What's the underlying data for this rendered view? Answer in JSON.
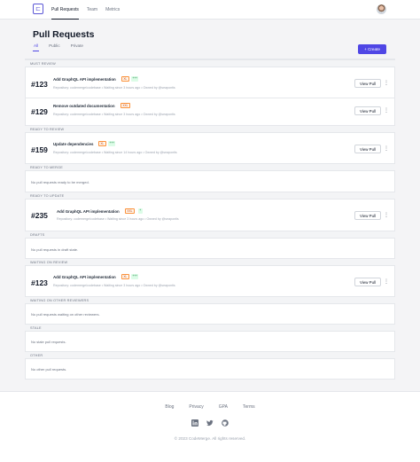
{
  "topbar": {
    "logo_glyph": "⊏",
    "nav": [
      "Pull Requests",
      "Team",
      "Metrics"
    ]
  },
  "header": {
    "title": "Pull Requests",
    "tabs": [
      "All",
      "Public",
      "Private"
    ],
    "create_label": "+ Create"
  },
  "sections": [
    {
      "heading": "MUST REVIEW"
    },
    {
      "heading": "READY TO REVIEW"
    },
    {
      "heading": "READY TO MERGE",
      "empty": "No pull requests ready to be merged."
    },
    {
      "heading": "READY TO UPDATE"
    },
    {
      "heading": "DRAFTS",
      "empty": "No pull requests in draft state."
    },
    {
      "heading": "WAITING ON REVIEW"
    },
    {
      "heading": "WAITING ON OTHER REVIEWERS",
      "empty": "No pull requests waiting on other reviewers."
    },
    {
      "heading": "STALE",
      "empty": "No stale pull requests."
    },
    {
      "heading": "OTHER",
      "empty": "No other pull requests."
    }
  ],
  "prs": [
    {
      "number": "#123",
      "title": "Add GraphQL API implementation",
      "size": "XL",
      "diff": "+++",
      "meta": "Repository: codemerge/codebase  •  Waiting since 3 hours ago  •  Owned by @seapontis",
      "action": "View Pull",
      "more": "⋮"
    },
    {
      "number": "#129",
      "title": "Remove outdated documentation",
      "size": "XXL",
      "diff": "",
      "meta": "Repository: codemerge/codebase  •  Waiting since 3 hours ago  •  Owned by @seapontis",
      "action": "View Pull",
      "more": "⋮"
    },
    {
      "number": "#159",
      "title": "Update dependencies",
      "size": "XL",
      "diff": "+++",
      "meta": "Repository: codemerge/codebase  •  Waiting since 14 hours ago  •  Owned by @seapontis",
      "action": "View Pull",
      "more": "⋮"
    },
    {
      "number": "#235",
      "title": "Add GraphQL API implementation",
      "size": "XXL",
      "diff": "+",
      "meta": "Repository: codemerge/codebase  •  Waiting since 3 hours ago  •  Owned by @seapontis",
      "action": "View Pull",
      "more": "⋮"
    },
    {
      "number": "#123",
      "title": "Add GraphQL API implementation",
      "size": "XL",
      "diff": "+++",
      "meta": "Repository: codemerge/codebase  •  Waiting since 3 hours ago  •  Owned by @seapontis",
      "action": "View Pull",
      "more": "⋮"
    }
  ],
  "footer": {
    "links": [
      "Blog",
      "Privacy",
      "GPA",
      "Terms"
    ],
    "social": [
      "linkedin-icon",
      "twitter-icon",
      "github-icon"
    ],
    "copyright": "© 2023 CodeMerge. All rights reserved."
  },
  "colors": {
    "accent": "#4f46e5",
    "size_badge": "#fb923c",
    "diff_badge": "#15803d"
  }
}
